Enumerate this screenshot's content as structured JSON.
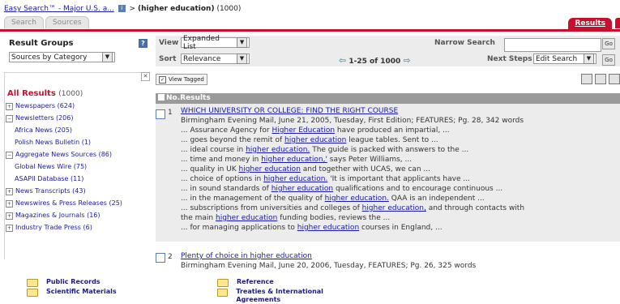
{
  "breadcrumb": {
    "link": "Easy Search™ - Major U.S. a...",
    "separator": ">",
    "query": "(higher education)",
    "count": "(1000)"
  },
  "tabs": {
    "search": "Search",
    "sources": "Sources",
    "results": "Results"
  },
  "result_groups": {
    "title": "Result Groups",
    "selector_value": "Sources by Category",
    "all_results_label": "All Results",
    "all_results_count": "(1000)",
    "items": [
      {
        "label": "Newspapers (624)",
        "expander": "+",
        "sub": false
      },
      {
        "label": "Newsletters (206)",
        "expander": "−",
        "sub": false
      },
      {
        "label": "Africa News (205)",
        "expander": "",
        "sub": true
      },
      {
        "label": "Polish News Bulletin (1)",
        "expander": "",
        "sub": true
      },
      {
        "label": "Aggregate News Sources (86)",
        "expander": "−",
        "sub": false
      },
      {
        "label": "Global News Wire (75)",
        "expander": "",
        "sub": true
      },
      {
        "label": "ASAPII Database (11)",
        "expander": "",
        "sub": true
      },
      {
        "label": "News Transcripts (43)",
        "expander": "+",
        "sub": false
      },
      {
        "label": "Newswires & Press Releases (25)",
        "expander": "+",
        "sub": false
      },
      {
        "label": "Magazines & Journals (16)",
        "expander": "+",
        "sub": false
      },
      {
        "label": "Industry Trade Press (6)",
        "expander": "+",
        "sub": false
      }
    ]
  },
  "controls": {
    "view_label": "View",
    "view_value": "Expanded List",
    "sort_label": "Sort",
    "sort_value": "Relevance",
    "pager": "1-25 of 1000",
    "narrow_label": "Narrow Search",
    "narrow_value": "",
    "go": "Go",
    "next_steps_label": "Next Steps",
    "next_steps_value": "Edit Search",
    "view_tagged": "View Tagged"
  },
  "results_header": {
    "no": "No.",
    "results": "Results"
  },
  "results": [
    {
      "num": "1",
      "title": "WHICH UNIVERSITY OR COLLEGE: FIND THE RIGHT COURSE",
      "meta": "Birmingham Evening Mail, June 21, 2005, Tuesday, First Edition; FEATURES; Pg. 28, 342 words",
      "snippets": [
        [
          "... Assurance Agency for ",
          "Higher Education",
          " have produced an impartial, ..."
        ],
        [
          "... goes beyond the remit of ",
          "higher education",
          " league tables. Sent to ..."
        ],
        [
          "... ideal course in ",
          "higher education.",
          " The guide is packed with answers to the ..."
        ],
        [
          "... time and money in ",
          "higher education,'",
          " says Peter Williams, ..."
        ],
        [
          "... quality in UK ",
          "higher education",
          " and together with UCAS, we can ..."
        ],
        [
          "... choice of options in ",
          "higher education.",
          " 'It is important that applicants have ..."
        ],
        [
          "... in sound standards of ",
          "higher education",
          " qualifications and to encourage continuous ..."
        ],
        [
          "... in the management of the quality of ",
          "higher education.",
          " QAA is an independent ..."
        ],
        [
          "... subscriptions from universities and colleges of ",
          "higher education,",
          " and through contacts with"
        ],
        [
          "the main ",
          "higher education",
          " funding bodies, reviews the ..."
        ],
        [
          "... for managing applications to ",
          "higher education",
          " courses in England, ..."
        ]
      ]
    },
    {
      "num": "2",
      "title": "Plenty of choice in higher education",
      "meta": "Birmingham Evening Mail, June 20, 2006, Tuesday, FEATURES; Pg. 26, 325 words",
      "snippets": []
    }
  ],
  "folders": [
    {
      "label": "Public Records"
    },
    {
      "label": "Scientific Materials"
    },
    {
      "label": "Reference"
    },
    {
      "label": "Treaties & International Agreements"
    }
  ]
}
